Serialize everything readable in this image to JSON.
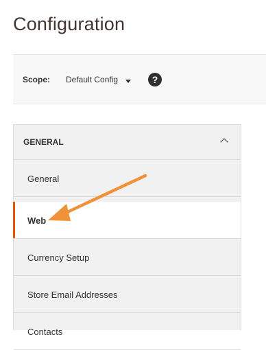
{
  "page": {
    "title": "Configuration"
  },
  "scope": {
    "label": "Scope:",
    "selected": "Default Config",
    "help_glyph": "?"
  },
  "sidebar": {
    "section_title": "GENERAL",
    "items": [
      {
        "label": "General",
        "active": false
      },
      {
        "label": "Web",
        "active": true
      },
      {
        "label": "Currency Setup",
        "active": false
      },
      {
        "label": "Store Email Addresses",
        "active": false
      },
      {
        "label": "Contacts",
        "active": false
      }
    ]
  },
  "colors": {
    "accent": "#eb5202",
    "annotation_arrow": "#f0923a"
  }
}
